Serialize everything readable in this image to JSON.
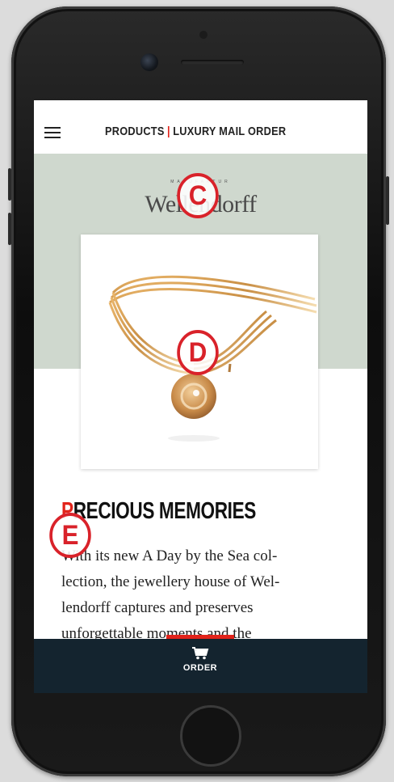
{
  "topbar": {
    "title_left": "PRODUCTS",
    "separator": "|",
    "title_right": "LUXURY MAIL ORDER",
    "menu_icon": "hamburger-icon"
  },
  "hero": {
    "brand_subtitle": "MANUFAKTUR",
    "brand_name": "Wellendorff",
    "background_color": "#cfd8ce"
  },
  "article": {
    "headline_first_letter": "P",
    "headline_rest": "RECIOUS MEMORIES",
    "body_lines": [
      "With its new A Day by the Sea col-",
      "lection, the jewellery house of Wel-",
      "lendorff captures and preserves",
      "unforgettable moments and the"
    ]
  },
  "bottom_bar": {
    "order_label": "ORDER",
    "order_icon": "cart-icon",
    "background_color": "#14242f",
    "accent_color": "#e2231a"
  },
  "markers": {
    "c": "C",
    "d": "D",
    "e": "E"
  }
}
